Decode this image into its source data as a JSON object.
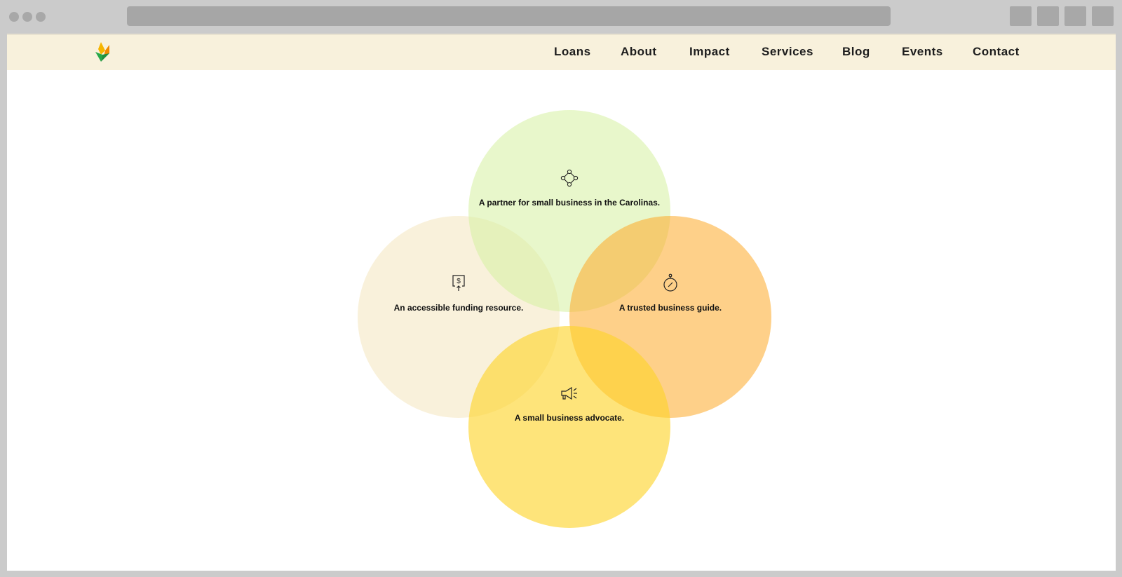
{
  "nav": {
    "items": [
      {
        "label": "Loans"
      },
      {
        "label": "About"
      },
      {
        "label": "Impact"
      },
      {
        "label": "Services"
      },
      {
        "label": "Blog"
      },
      {
        "label": "Events"
      },
      {
        "label": "Contact"
      }
    ]
  },
  "venn": {
    "top": {
      "text": "A partner for small business in the Carolinas.",
      "icon": "network-icon"
    },
    "left": {
      "text": "An accessible funding resource.",
      "icon": "dollar-document-icon"
    },
    "right": {
      "text": "A trusted business guide.",
      "icon": "compass-icon"
    },
    "bottom": {
      "text": "A small business advocate.",
      "icon": "megaphone-icon"
    }
  },
  "colors": {
    "header_bg": "#f8f1dc",
    "circle_top": "#e8f6c8",
    "circle_left": "#f9f1dc",
    "circle_right": "#fecf86",
    "circle_bottom": "#fde47a",
    "logo_yellow": "#f6b500",
    "logo_orange": "#f08a00",
    "logo_green": "#27a84a"
  }
}
